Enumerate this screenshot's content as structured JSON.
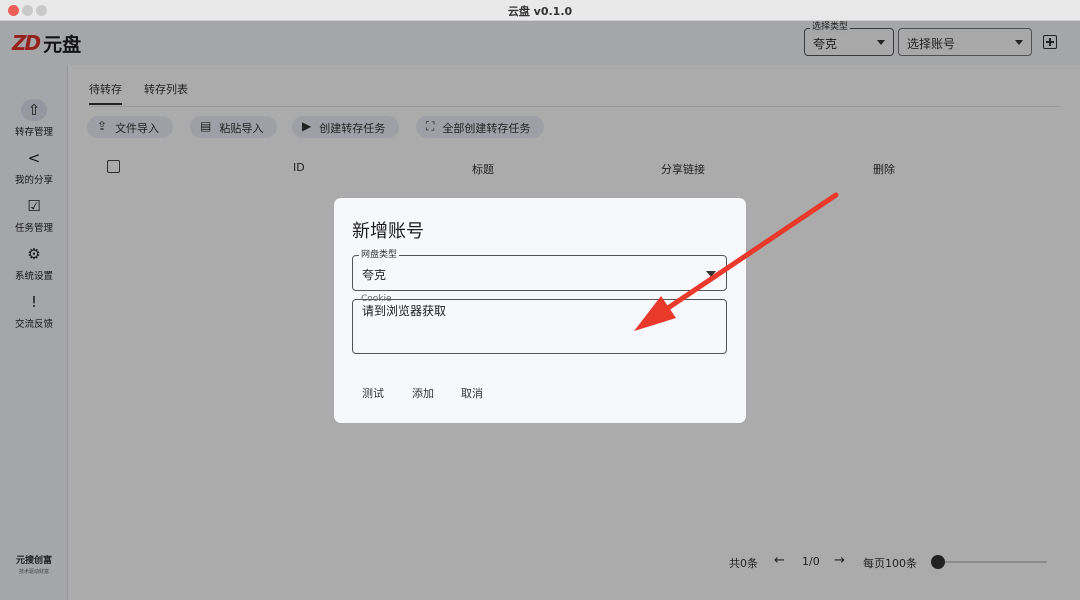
{
  "window": {
    "title": "云盘 v0.1.0"
  },
  "app": {
    "brand_mark": "ZD",
    "brand_name": "元盘",
    "type_select": {
      "legend": "选择类型",
      "value": "夸克"
    },
    "account_select": {
      "placeholder": "选择账号"
    }
  },
  "sidebar": {
    "items": [
      {
        "label": "转存管理",
        "icon": "share-upload-icon",
        "glyph": "⇧"
      },
      {
        "label": "我的分享",
        "icon": "share-nodes-icon",
        "glyph": "<"
      },
      {
        "label": "任务管理",
        "icon": "task-check-icon",
        "glyph": "☑"
      },
      {
        "label": "系统设置",
        "icon": "gear-icon",
        "glyph": "⚙"
      },
      {
        "label": "交流反馈",
        "icon": "feedback-icon",
        "glyph": "!"
      }
    ],
    "footer_brand": "元搜创富",
    "footer_slogan": "技术驱动财富"
  },
  "tabs": [
    "待转存",
    "转存列表"
  ],
  "toolbar": [
    {
      "label": "文件导入",
      "icon": "file-upload-icon",
      "glyph": "⇪"
    },
    {
      "label": "粘贴导入",
      "icon": "clipboard-icon",
      "glyph": "▤"
    },
    {
      "label": "创建转存任务",
      "icon": "play-circle-icon",
      "glyph": "▶"
    },
    {
      "label": "全部创建转存任务",
      "icon": "select-all-icon",
      "glyph": "⛶"
    }
  ],
  "table": {
    "columns": [
      "ID",
      "标题",
      "分享链接",
      "删除"
    ]
  },
  "pagination": {
    "total": "共0条",
    "prev": "←",
    "page": "1/0",
    "next": "→",
    "per_page": "每页100条"
  },
  "dialog": {
    "title": "新增账号",
    "type_field": {
      "legend": "网盘类型",
      "value": "夸克"
    },
    "cookie_field": {
      "legend": "Cookie",
      "value": "请到浏览器获取"
    },
    "buttons": {
      "test": "测试",
      "add": "添加",
      "cancel": "取消"
    }
  },
  "colors": {
    "annotation_arrow": "#e8392a",
    "brand_red": "#e0332c"
  }
}
